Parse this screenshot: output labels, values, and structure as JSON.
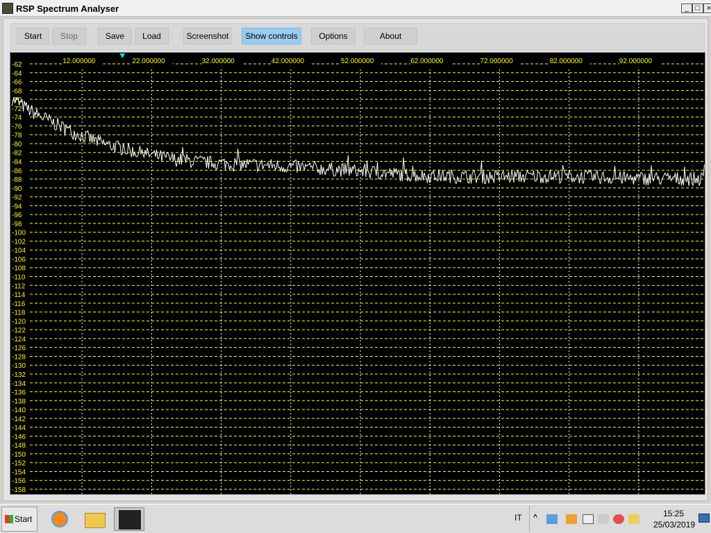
{
  "window": {
    "title": "RSP Spectrum Analyser",
    "controls": [
      "_",
      "□",
      "×"
    ]
  },
  "toolbar": {
    "buttons": [
      {
        "label": "Start",
        "enabled": true
      },
      {
        "label": "Stop",
        "enabled": false
      },
      {
        "label": "Save",
        "enabled": true
      },
      {
        "label": "Load",
        "enabled": true
      },
      {
        "label": "Screenshot",
        "enabled": true
      },
      {
        "label": "Show controls",
        "enabled": true,
        "active": true
      },
      {
        "label": "Options",
        "enabled": true
      },
      {
        "label": "About",
        "enabled": true
      }
    ]
  },
  "chart_data": {
    "type": "line",
    "x_unit": "MHz",
    "xlim": [
      1.9,
      101.5
    ],
    "ylim": [
      -158,
      -62
    ],
    "x_tick_labels": [
      "12.000000",
      "22.000000",
      "32.000000",
      "42.000000",
      "52.000000",
      "62.000000",
      "72.000000",
      "82.000000",
      "92.000000"
    ],
    "x_ticks": [
      12,
      22,
      32,
      42,
      52,
      62,
      72,
      82,
      92
    ],
    "y_ticks": [
      -62,
      -64,
      -66,
      -68,
      -70,
      -72,
      -74,
      -76,
      -78,
      -80,
      -82,
      -84,
      -86,
      -88,
      -90,
      -92,
      -94,
      -96,
      -98,
      -100,
      -102,
      -104,
      -106,
      -108,
      -110,
      -112,
      -114,
      -116,
      -118,
      -120,
      -122,
      -124,
      -126,
      -128,
      -130,
      -132,
      -134,
      -136,
      -138,
      -140,
      -142,
      -144,
      -146,
      -148,
      -150,
      -152,
      -154,
      -156,
      -158
    ],
    "grid": true,
    "marker_x": 17.8,
    "colors": {
      "background": "#000000",
      "trace": "#ffffff",
      "labels": "#ffff00",
      "marker": "#00e0e0"
    },
    "series": [
      {
        "x": [
          2,
          5,
          10,
          15,
          20,
          25,
          30,
          40,
          50,
          60,
          70,
          80,
          90,
          101.5
        ],
        "y": [
          -70,
          -73,
          -77,
          -80,
          -82,
          -83.5,
          -84.3,
          -85,
          -86,
          -87.2,
          -87.5,
          -87.3,
          -87.8,
          -88
        ]
      }
    ]
  },
  "taskbar": {
    "start_label": "Start",
    "language": "IT",
    "time": "15:25",
    "date": "25/03/2019"
  }
}
